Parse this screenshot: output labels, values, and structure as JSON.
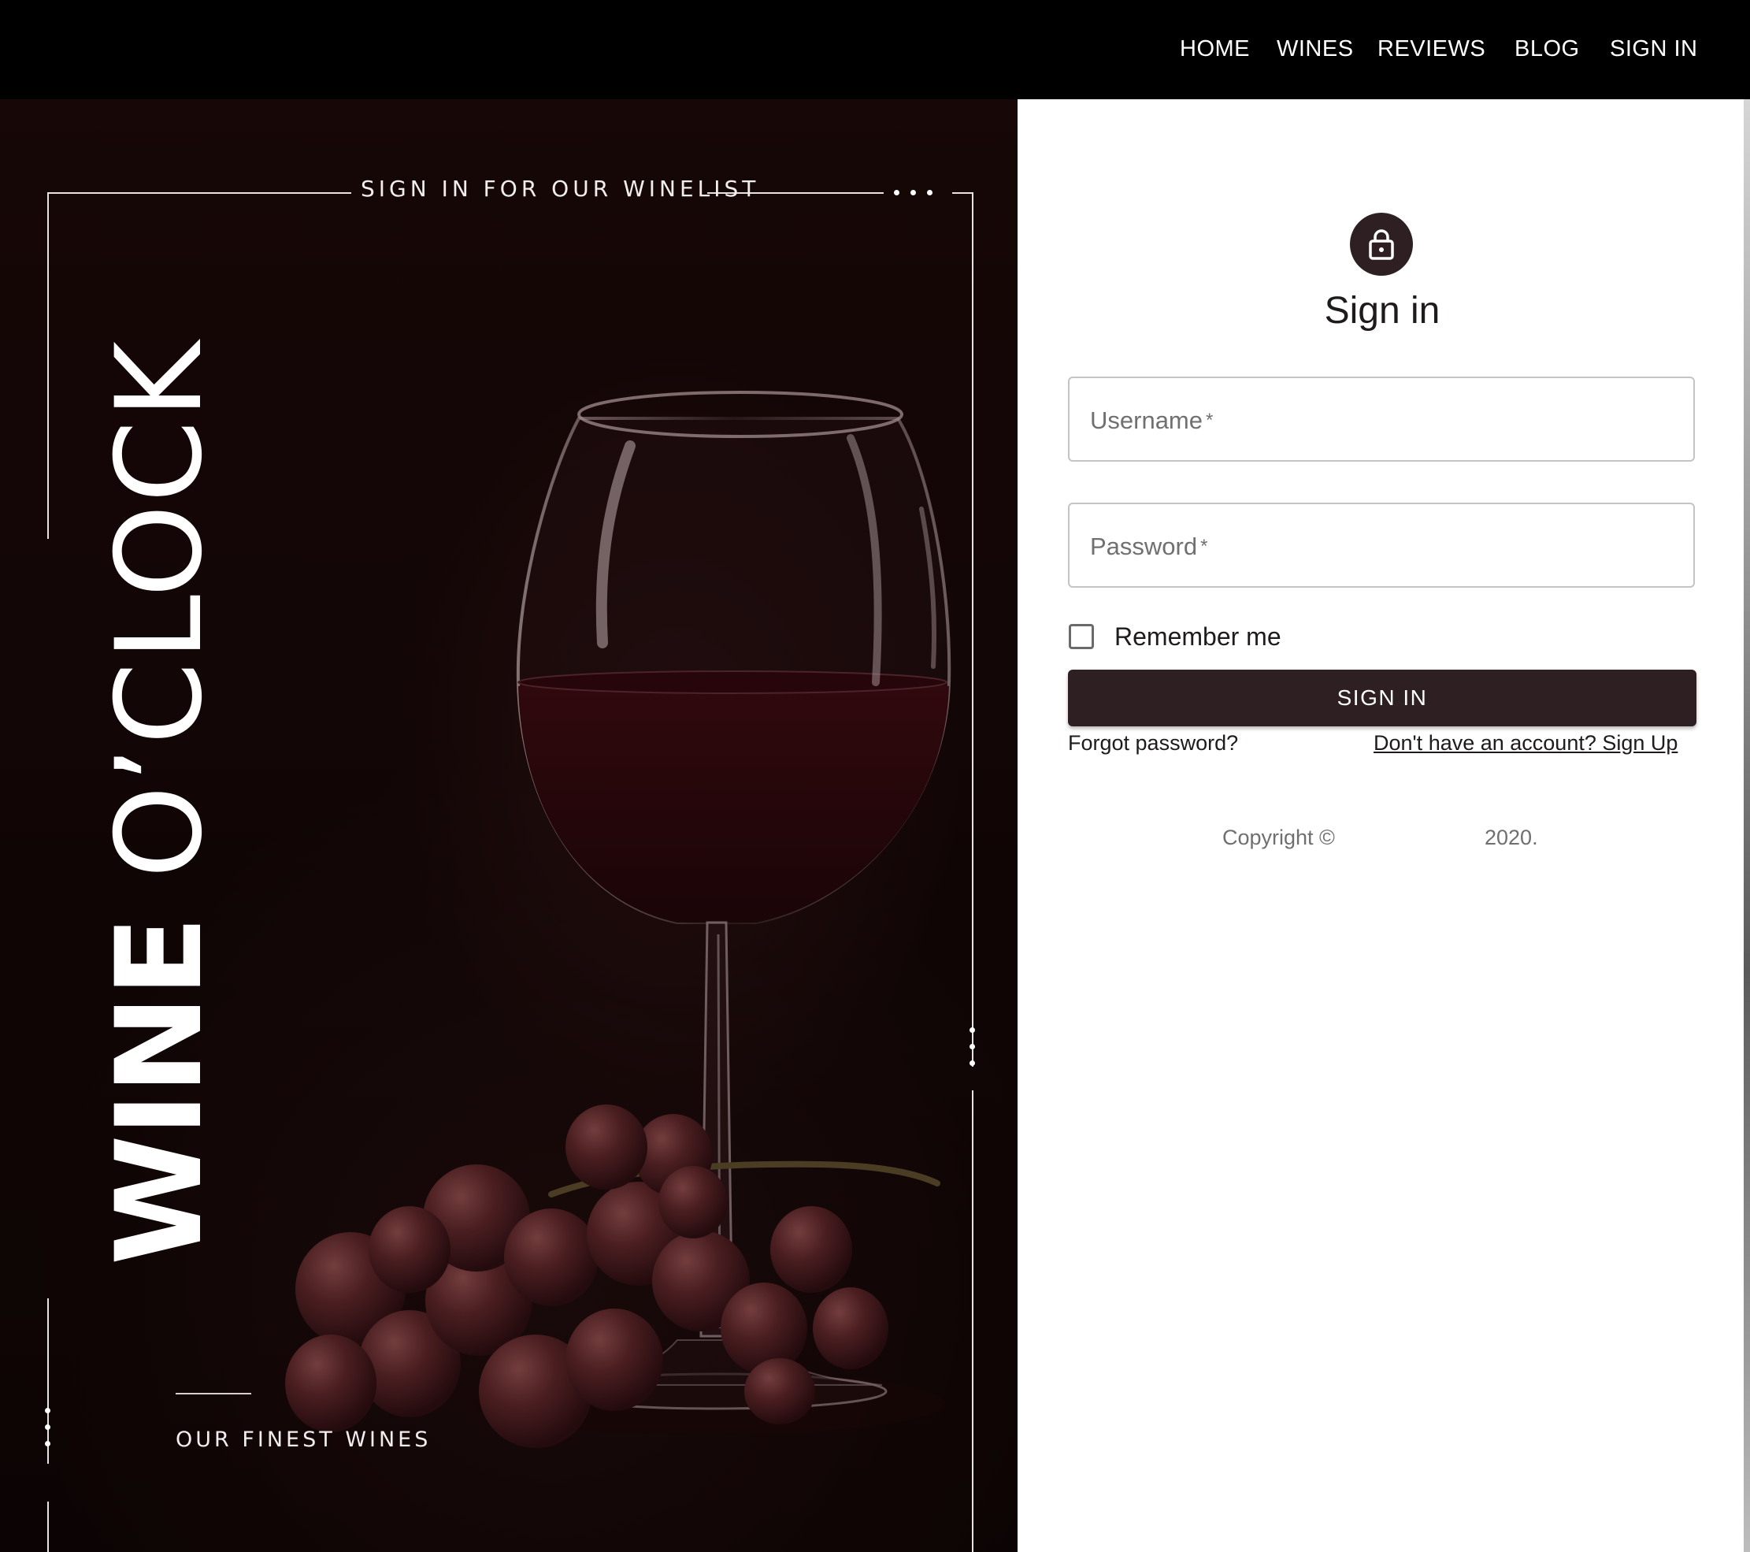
{
  "nav": {
    "items": [
      {
        "label": "HOME"
      },
      {
        "label": "WINES"
      },
      {
        "label": "REVIEWS"
      },
      {
        "label": "BLOG"
      },
      {
        "label": "SIGN IN"
      }
    ]
  },
  "hero": {
    "caption": "SIGN IN FOR OUR WINELIST",
    "title_bold": "WINE",
    "title_light": "O’CLOCK",
    "subtitle": "OUR FINEST WINES"
  },
  "signin": {
    "icon": "lock-icon",
    "title": "Sign in",
    "username": {
      "label": "Username",
      "required_mark": "*",
      "value": ""
    },
    "password": {
      "label": "Password",
      "required_mark": "*",
      "value": ""
    },
    "remember_label": "Remember me",
    "remember_checked": false,
    "submit_label": "SIGN IN",
    "forgot_label": "Forgot password?",
    "signup_label": "Don't have an account? Sign Up",
    "copyright_prefix": "Copyright ©",
    "copyright_year": "2020."
  },
  "colors": {
    "topbar": "#000000",
    "accent": "#2e1f22",
    "hero_background": "#140606"
  }
}
